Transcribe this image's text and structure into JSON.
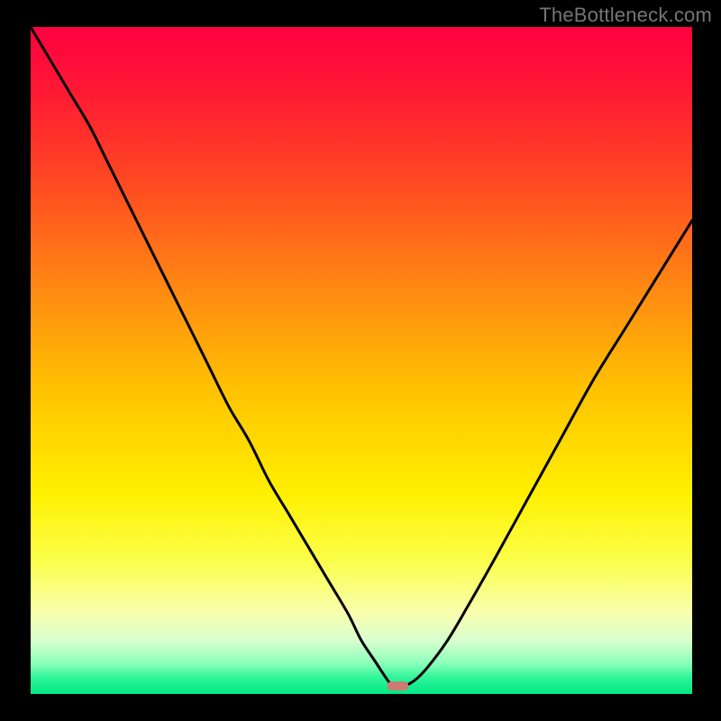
{
  "watermark": "TheBottleneck.com",
  "chart_data": {
    "type": "line",
    "title": "",
    "xlabel": "",
    "ylabel": "",
    "xlim": [
      0,
      100
    ],
    "ylim": [
      0,
      100
    ],
    "grid": false,
    "legend": false,
    "annotations": [],
    "background": {
      "type": "vertical-gradient",
      "stops": [
        {
          "pos": 0.0,
          "color": "#ff0040"
        },
        {
          "pos": 0.1,
          "color": "#ff1a33"
        },
        {
          "pos": 0.25,
          "color": "#ff5020"
        },
        {
          "pos": 0.4,
          "color": "#ff8c12"
        },
        {
          "pos": 0.55,
          "color": "#ffc400"
        },
        {
          "pos": 0.7,
          "color": "#fff000"
        },
        {
          "pos": 0.8,
          "color": "#fbff4a"
        },
        {
          "pos": 0.88,
          "color": "#f8ffb0"
        },
        {
          "pos": 0.92,
          "color": "#d8ffcf"
        },
        {
          "pos": 0.955,
          "color": "#88ffb8"
        },
        {
          "pos": 0.975,
          "color": "#30f59a"
        },
        {
          "pos": 1.0,
          "color": "#00e884"
        }
      ]
    },
    "series": [
      {
        "name": "bottleneck-curve",
        "color": "#000000",
        "x": [
          0,
          3,
          6,
          9,
          12,
          15,
          18,
          21,
          24,
          27,
          30,
          33,
          36,
          39,
          42,
          45,
          48,
          50,
          52,
          54,
          55,
          56,
          58,
          60,
          63,
          66,
          70,
          75,
          80,
          85,
          90,
          95,
          100
        ],
        "values": [
          100,
          95,
          90,
          85,
          79,
          73,
          67,
          61,
          55,
          49,
          43,
          38,
          32,
          27,
          22,
          17,
          12,
          8,
          5,
          2,
          1,
          1,
          2,
          4,
          8,
          13,
          20,
          29,
          38,
          47,
          55,
          63,
          71
        ]
      }
    ],
    "marker": {
      "name": "optimal-point",
      "x": 55.5,
      "y": 1.2,
      "color": "#cd7a72"
    }
  }
}
